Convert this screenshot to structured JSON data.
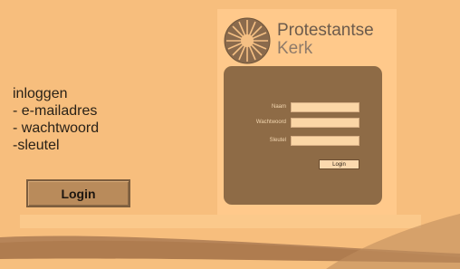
{
  "instructions": {
    "title": "inloggen",
    "lines": [
      "- e-mailadres",
      "- wachtwoord",
      "-sleutel"
    ]
  },
  "login_button": {
    "label": "Login"
  },
  "brand": {
    "line1": "Protestantse",
    "line2": "Kerk"
  },
  "form": {
    "name_label": "Naam",
    "password_label": "Wachtwoord",
    "key_label": "Sleutel",
    "submit_label": "Login"
  },
  "colors": {
    "background": "#f7be7d",
    "panel": "#8e6b46",
    "field": "#fbd6a6"
  }
}
